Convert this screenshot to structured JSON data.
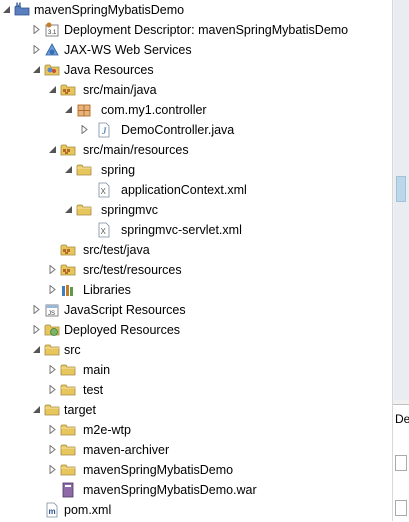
{
  "tree": [
    {
      "label": "mavenSpringMybatisDemo",
      "icon": "maven-project-icon",
      "expanded": true
    },
    {
      "label": "Deployment Descriptor: mavenSpringMybatisDemo",
      "icon": "deployment-descriptor-icon",
      "expanded": false
    },
    {
      "label": "JAX-WS Web Services",
      "icon": "web-services-icon",
      "expanded": false
    },
    {
      "label": "Java Resources",
      "icon": "java-resources-icon",
      "expanded": true
    },
    {
      "label": "src/main/java",
      "icon": "source-folder-icon",
      "expanded": true
    },
    {
      "label": "com.my1.controller",
      "icon": "package-icon",
      "expanded": true
    },
    {
      "label": "DemoController.java",
      "icon": "java-file-icon",
      "expanded": false
    },
    {
      "label": "src/main/resources",
      "icon": "source-folder-icon",
      "expanded": true
    },
    {
      "label": "spring",
      "icon": "folder-icon",
      "expanded": true
    },
    {
      "label": "applicationContext.xml",
      "icon": "xml-file-icon"
    },
    {
      "label": "springmvc",
      "icon": "folder-icon",
      "expanded": true
    },
    {
      "label": "springmvc-servlet.xml",
      "icon": "xml-file-icon"
    },
    {
      "label": "src/test/java",
      "icon": "source-folder-icon"
    },
    {
      "label": "src/test/resources",
      "icon": "source-folder-icon",
      "expanded": false
    },
    {
      "label": "Libraries",
      "icon": "libraries-icon",
      "expanded": false
    },
    {
      "label": "JavaScript Resources",
      "icon": "javascript-resources-icon",
      "expanded": false
    },
    {
      "label": "Deployed Resources",
      "icon": "deployed-resources-icon",
      "expanded": false
    },
    {
      "label": "src",
      "icon": "folder-icon",
      "expanded": true
    },
    {
      "label": "main",
      "icon": "folder-icon",
      "expanded": false
    },
    {
      "label": "test",
      "icon": "folder-icon",
      "expanded": false
    },
    {
      "label": "target",
      "icon": "folder-icon",
      "expanded": true
    },
    {
      "label": "m2e-wtp",
      "icon": "folder-icon",
      "expanded": false
    },
    {
      "label": "maven-archiver",
      "icon": "folder-icon",
      "expanded": false
    },
    {
      "label": "mavenSpringMybatisDemo",
      "icon": "folder-icon",
      "expanded": false
    },
    {
      "label": "mavenSpringMybatisDemo.war",
      "icon": "war-file-icon"
    },
    {
      "label": "pom.xml",
      "icon": "pom-file-icon"
    }
  ],
  "right_panel": {
    "tab_label": "De"
  },
  "colors": {
    "folder": "#e8c65e",
    "java": "#5a8ac6",
    "package": "#b36b2a"
  }
}
